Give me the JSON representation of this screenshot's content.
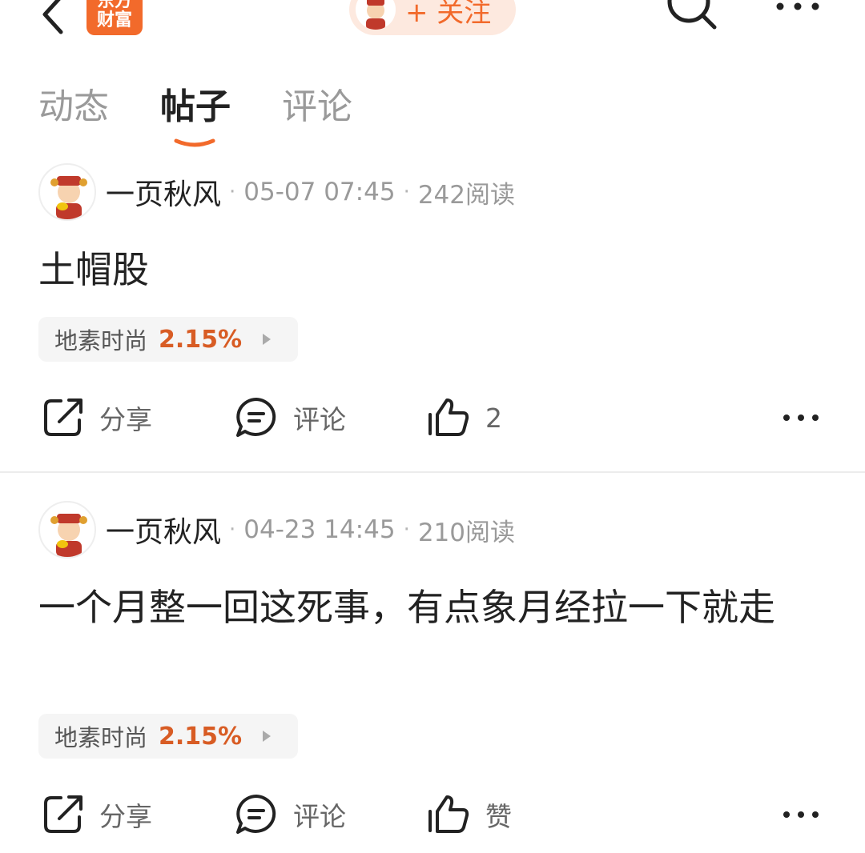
{
  "topbar": {
    "brand_line1": "东方",
    "brand_line2": "财富",
    "follow_label": "+ 关注",
    "icons": [
      "back-icon",
      "search-icon",
      "more-icon"
    ]
  },
  "tabs": [
    {
      "label": "动态",
      "active": false
    },
    {
      "label": "帖子",
      "active": true
    },
    {
      "label": "评论",
      "active": false
    }
  ],
  "posts": [
    {
      "author": "一页秋风",
      "date": "05-07 07:45",
      "reads": "242阅读",
      "content": "土帽股",
      "stock_name": "地素时尚",
      "stock_change": "2.15%",
      "share_label": "分享",
      "comment_label": "评论",
      "like_label": "2"
    },
    {
      "author": "一页秋风",
      "date": "04-23 14:45",
      "reads": "210阅读",
      "content": "一个月整一回这死事，有点象月经拉一下就走",
      "stock_name": "地素时尚",
      "stock_change": "2.15%",
      "share_label": "分享",
      "comment_label": "评论",
      "like_label": "赞"
    }
  ],
  "colors": {
    "accent": "#f26a2b",
    "stock_up": "#d85c24",
    "muted": "#9a9a9a"
  }
}
